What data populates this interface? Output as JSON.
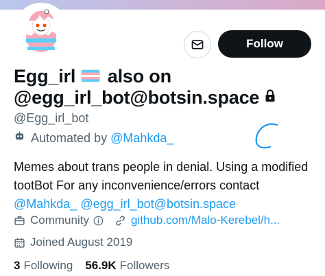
{
  "colors": {
    "accent": "#1d9bf0",
    "text": "#0f1419",
    "muted": "#536471",
    "follow_bg": "#0f1419"
  },
  "header": {
    "follow_label": "Follow",
    "message_icon": "envelope-icon"
  },
  "profile": {
    "name_part1": "Egg_irl",
    "name_part2": "also on",
    "name_line2": "@egg_irl_bot@botsin.space",
    "flag": "transgender-flag-emoji",
    "protected_icon": "lock-icon",
    "handle": "@Egg_irl_bot",
    "automated_prefix": "Automated by",
    "automated_by": "@Mahkda_"
  },
  "bio": {
    "text": "Memes about trans people in denial. Using a modified tootBot For any inconvenience/errors contact",
    "mention1": "@Mahkda_",
    "mention2": "@egg_irl_bot@botsin.space"
  },
  "meta": {
    "category": "Community",
    "website": "github.com/Malo-Kerebel/h...",
    "joined": "Joined August 2019"
  },
  "stats": {
    "following_count": "3",
    "following_label": "Following",
    "followers_count": "56.9K",
    "followers_label": "Followers"
  }
}
